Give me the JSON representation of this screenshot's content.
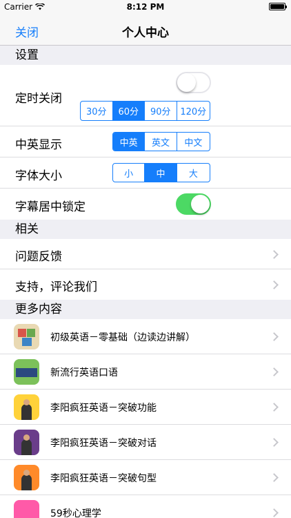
{
  "status": {
    "carrier": "Carrier",
    "time": "8:12 PM"
  },
  "nav": {
    "close": "关闭",
    "title": "个人中心"
  },
  "settings": {
    "header": "设置",
    "timer": {
      "label": "定时关闭",
      "enabled": false,
      "options": [
        "30分",
        "60分",
        "90分",
        "120分"
      ],
      "selected": "60分"
    },
    "display": {
      "label": "中英显示",
      "options": [
        "中英",
        "英文",
        "中文"
      ],
      "selected": "中英"
    },
    "fontsize": {
      "label": "字体大小",
      "options": [
        "小",
        "中",
        "大"
      ],
      "selected": "中"
    },
    "lock": {
      "label": "字幕居中锁定",
      "enabled": true
    }
  },
  "related": {
    "header": "相关",
    "items": [
      {
        "label": "问题反馈"
      },
      {
        "label": "支持，评论我们"
      }
    ]
  },
  "more": {
    "header": "更多内容",
    "apps": [
      {
        "label": "初级英语－零基础（边读边讲解）",
        "icon": "blocks-icon",
        "color": "#e9d9b3"
      },
      {
        "label": "新流行英语口语",
        "icon": "spoken-english-icon",
        "color": "#7cc15a"
      },
      {
        "label": "李阳疯狂英语－突破功能",
        "icon": "crazy-english-function-icon",
        "color": "#ffd23a"
      },
      {
        "label": "李阳疯狂英语－突破对话",
        "icon": "crazy-english-dialogue-icon",
        "color": "#6a3d8a"
      },
      {
        "label": "李阳疯狂英语－突破句型",
        "icon": "crazy-english-sentence-icon",
        "color": "#ff8a2a"
      },
      {
        "label": "59秒心理学",
        "icon": "psychology-icon",
        "color": "#ff5aa8"
      }
    ]
  },
  "colors": {
    "accent": "#157efb",
    "toggle_on": "#4cd964"
  }
}
